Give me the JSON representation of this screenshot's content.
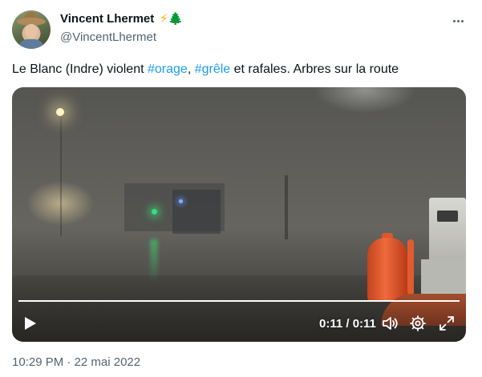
{
  "author": {
    "display_name": "Vincent Lhermet",
    "name_emoji": [
      "⚡",
      "🌲"
    ],
    "handle": "@VincentLhermet",
    "avatar_icon": "profile-photo"
  },
  "tweet": {
    "text_before": "Le Blanc (Indre) violent ",
    "hashtag_1": "#orage",
    "text_between": ", ",
    "hashtag_2": "#grêle",
    "text_after": " et rafales. Arbres sur la route",
    "timestamp": "10:29 PM · 22 mai 2022"
  },
  "video": {
    "time_readout": "0:11 / 0:11",
    "progress_fraction": 1.0,
    "icons": [
      "play-icon",
      "volume-icon",
      "settings-icon",
      "fullscreen-icon"
    ]
  },
  "colors": {
    "hashtag": "#1d9bf0",
    "secondary_text": "#536471",
    "primary_text": "#0f1419"
  }
}
